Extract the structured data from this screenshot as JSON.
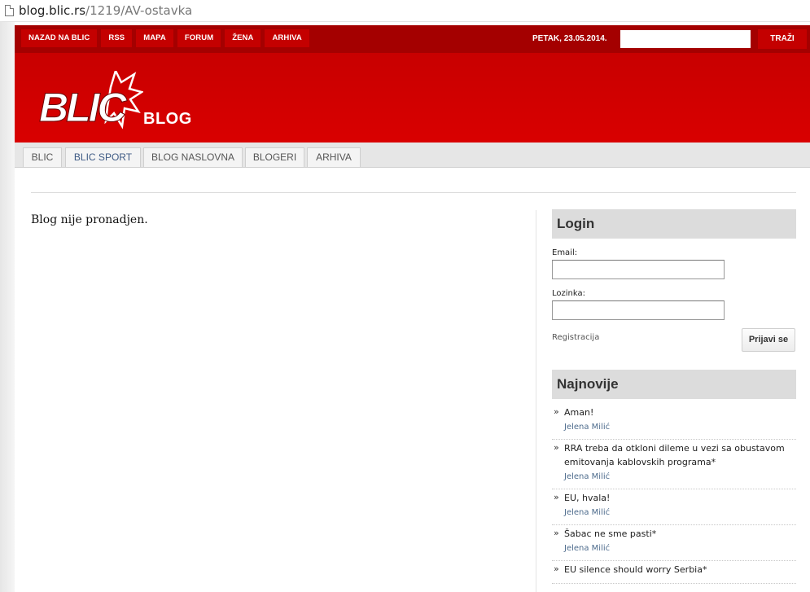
{
  "browser": {
    "url_host": "blog.blic.rs",
    "url_path": "/1219/AV-ostavka"
  },
  "topnav": {
    "items": [
      "NAZAD NA BLIC",
      "RSS",
      "MAPA",
      "FORUM",
      "ŽENA",
      "ARHIVA"
    ],
    "date": "PETAK, 23.05.2014.",
    "search_value": "",
    "search_button": "TRAŽI"
  },
  "logo": {
    "brand": "BLIC",
    "section": "BLOG"
  },
  "tabs": [
    "BLIC",
    "BLIC SPORT",
    "BLOG NASLOVNA",
    "BLOGERI",
    "ARHIVA"
  ],
  "main": {
    "message": "Blog nije pronadjen."
  },
  "login": {
    "title": "Login",
    "email_label": "Email:",
    "email_value": "",
    "password_label": "Lozinka:",
    "password_value": "",
    "register_link": "Registracija",
    "submit": "Prijavi se"
  },
  "latest": {
    "title": "Najnovije",
    "items": [
      {
        "title": "Aman!",
        "author": "Jelena Milić"
      },
      {
        "title": "RRA treba da otkloni dileme u vezi sa obustavom emitovanja kablovskih programa*",
        "author": "Jelena Milić"
      },
      {
        "title": "EU, hvala!",
        "author": "Jelena Milić"
      },
      {
        "title": "Šabac ne sme pasti*",
        "author": "Jelena Milić"
      },
      {
        "title": "EU silence should worry Serbia*",
        "author": ""
      }
    ]
  },
  "colors": {
    "brand_red": "#cc0000",
    "topbar_dark": "#a40000",
    "button_red": "#c40000",
    "author_link": "#4d6b8c"
  }
}
